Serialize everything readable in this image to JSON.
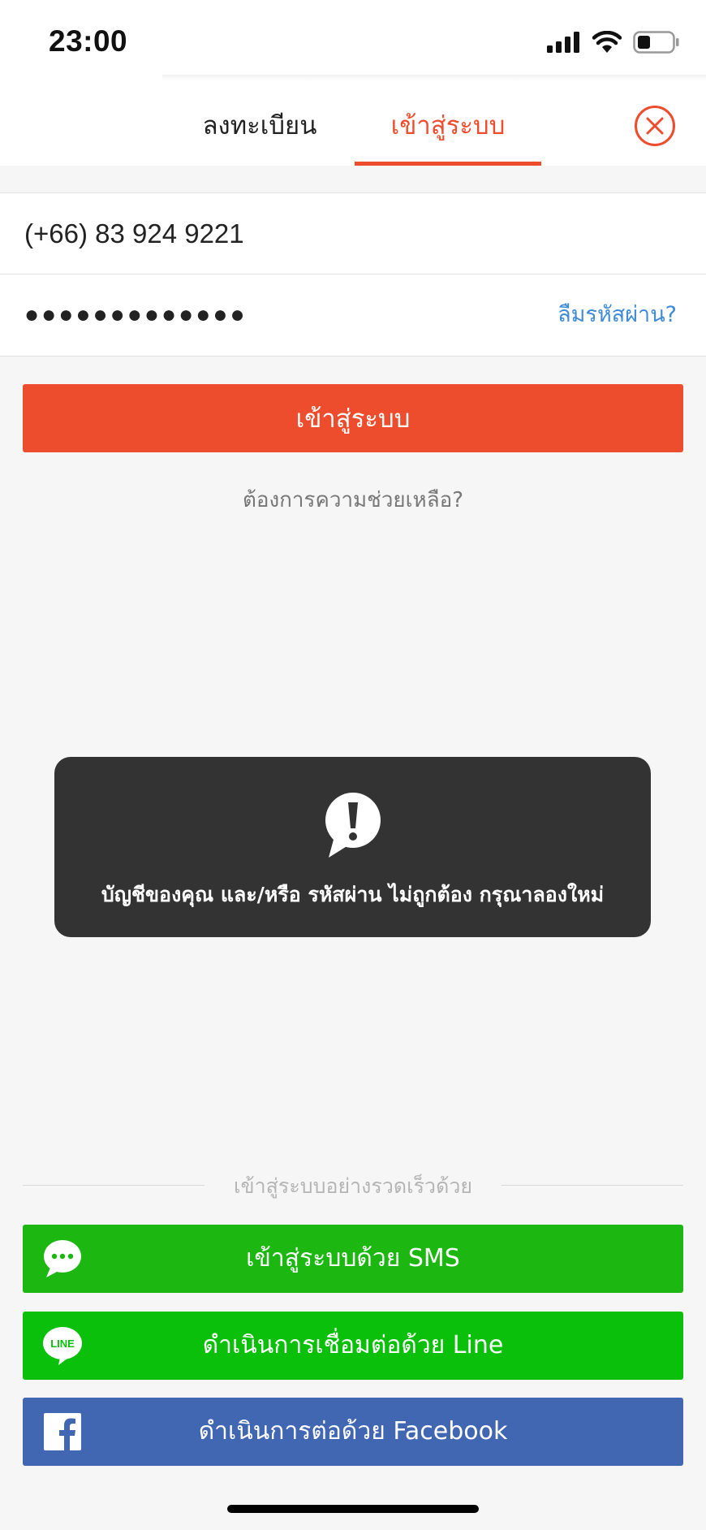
{
  "status_bar": {
    "time": "23:00"
  },
  "tabs": {
    "register_label": "ลงทะเบียน",
    "login_label": "เข้าสู่ระบบ"
  },
  "form": {
    "phone_value": "(+66) 83 924 9221",
    "password_value": "●●●●●●●●●●●●●",
    "forgot_password_label": "ลืมรหัสผ่าน?",
    "login_button_label": "เข้าสู่ระบบ",
    "help_label": "ต้องการความช่วยเหลือ?"
  },
  "toast": {
    "message": "บัญชีของคุณ และ/หรือ รหัสผ่าน ไม่ถูกต้อง กรุณาลองใหม่",
    "icon": "exclamation-bubble-icon"
  },
  "quick_login": {
    "divider_label": "เข้าสู่ระบบอย่างรวดเร็วด้วย",
    "sms_label": "เข้าสู่ระบบด้วย SMS",
    "line_label": "ดำเนินการเชื่อมต่อด้วย Line",
    "line_icon_text": "LINE",
    "facebook_label": "ดำเนินการต่อด้วย Facebook"
  },
  "colors": {
    "accent": "#ee4d2d",
    "link": "#3f8bd6",
    "sms": "#1db712",
    "line": "#0bc00b",
    "facebook": "#4267b2",
    "toast_bg": "#333333"
  }
}
